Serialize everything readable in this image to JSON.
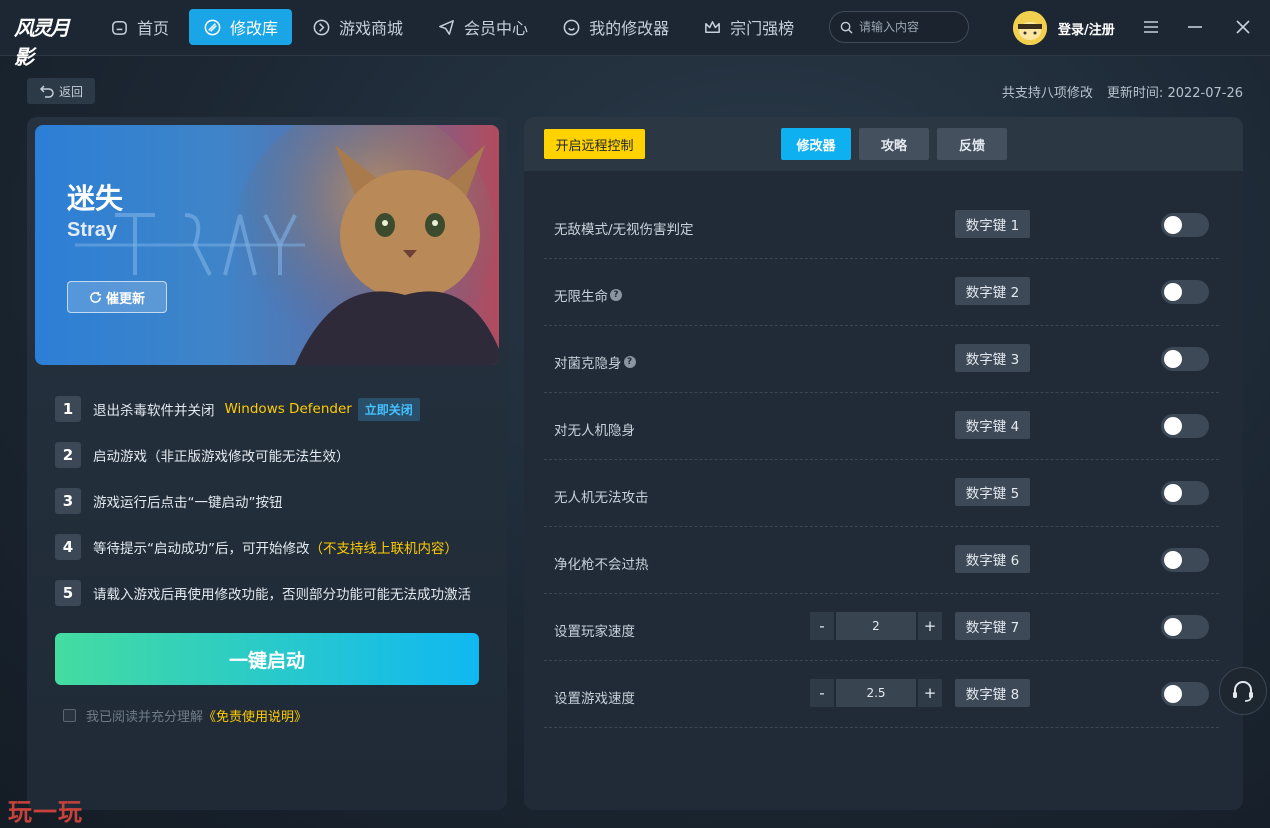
{
  "app": {
    "logo_text": "风灵月影"
  },
  "nav": {
    "items": [
      {
        "label": "首页"
      },
      {
        "label": "修改库"
      },
      {
        "label": "游戏商城"
      },
      {
        "label": "会员中心"
      },
      {
        "label": "我的修改器"
      },
      {
        "label": "宗门强榜"
      }
    ]
  },
  "search": {
    "placeholder": "请输入内容"
  },
  "user": {
    "login_label": "登录/注册"
  },
  "header": {
    "back_label": "返回",
    "support_count": "共支持八项修改",
    "update_label": "更新时间:",
    "update_date": "2022-07-26"
  },
  "game": {
    "title": "迷失",
    "subtitle": "Stray",
    "urge_update_label": "催更新"
  },
  "steps": [
    {
      "num": "1",
      "text": "退出杀毒软件并关闭",
      "highlight": "Windows Defender",
      "action": "立即关闭"
    },
    {
      "num": "2",
      "text": "启动游戏（非正版游戏修改可能无法生效）"
    },
    {
      "num": "3",
      "text": "游戏运行后点击“一键启动”按钮"
    },
    {
      "num": "4",
      "text": "等待提示“启动成功”后，可开始修改",
      "highlight": "（不支持线上联机内容）"
    },
    {
      "num": "5",
      "text": "请载入游戏后再使用修改功能，否则部分功能可能无法成功激活"
    }
  ],
  "start_button": "一键启动",
  "agreement": {
    "text": "我已阅读并充分理解",
    "link": "《免责使用说明》"
  },
  "right": {
    "remote_label": "开启远程控制",
    "tabs": [
      {
        "label": "修改器"
      },
      {
        "label": "攻略"
      },
      {
        "label": "反馈"
      }
    ],
    "cheats": [
      {
        "label": "无敌模式/无视伤害判定",
        "hotkey": "数字键 1",
        "enabled": false
      },
      {
        "label": "无限生命",
        "hotkey": "数字键 2",
        "enabled": false,
        "help": "?"
      },
      {
        "label": "对菌克隐身",
        "hotkey": "数字键 3",
        "enabled": false,
        "help": "?"
      },
      {
        "label": "对无人机隐身",
        "hotkey": "数字键 4",
        "enabled": false
      },
      {
        "label": "无人机无法攻击",
        "hotkey": "数字键 5",
        "enabled": false
      },
      {
        "label": "净化枪不会过热",
        "hotkey": "数字键 6",
        "enabled": false
      },
      {
        "label": "设置玩家速度",
        "hotkey": "数字键 7",
        "enabled": false,
        "stepper": {
          "minus": "-",
          "value": "2",
          "plus": "+"
        }
      },
      {
        "label": "设置游戏速度",
        "hotkey": "数字键 8",
        "enabled": false,
        "stepper": {
          "minus": "-",
          "value": "2.5",
          "plus": "+"
        }
      }
    ]
  },
  "watermark": "玩一玩",
  "colors": {
    "accent": "#1aa5e6",
    "yellow": "#ffcc00",
    "start_from": "#44dca0",
    "start_to": "#10b8f2"
  }
}
